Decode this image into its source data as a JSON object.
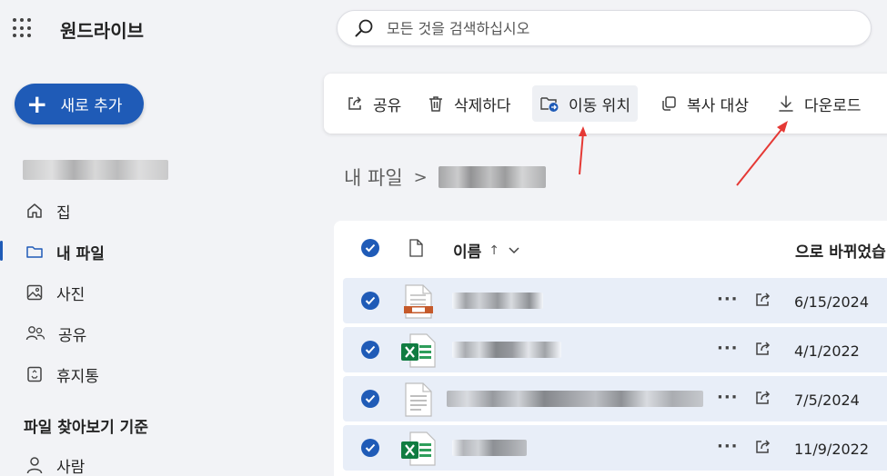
{
  "app": {
    "title": "원드라이브"
  },
  "search": {
    "placeholder": "모든 것을 검색하십시오"
  },
  "new_button": {
    "label": "새로 추가"
  },
  "nav": {
    "items": [
      {
        "label": "집",
        "icon": "home-icon"
      },
      {
        "label": "내 파일",
        "icon": "folder-icon",
        "active": true
      },
      {
        "label": "사진",
        "icon": "photo-icon"
      },
      {
        "label": "공유",
        "icon": "people-icon"
      },
      {
        "label": "휴지통",
        "icon": "recycle-bin-icon"
      }
    ],
    "section_heading": "파일 찾아보기 기준",
    "section_items": [
      {
        "label": "사람",
        "icon": "person-icon"
      }
    ]
  },
  "commands": {
    "share": "공유",
    "delete": "삭제하다",
    "move": "이동 위치",
    "copy": "복사 대상",
    "download": "다운로드"
  },
  "breadcrumb": {
    "root": "내 파일",
    "separator": ">"
  },
  "list": {
    "columns": {
      "name": "이름",
      "sort_indicator": "↑",
      "modified": "으로 바뀌었습"
    },
    "rows": [
      {
        "type": "presentation",
        "modified": "6/15/2024",
        "selected": true
      },
      {
        "type": "excel",
        "modified": "4/1/2022",
        "selected": true
      },
      {
        "type": "document",
        "modified": "7/5/2024",
        "selected": true
      },
      {
        "type": "excel",
        "modified": "11/9/2022",
        "selected": true
      }
    ],
    "more_label": "···"
  },
  "colors": {
    "accent": "#1f5bb7",
    "selected_row": "#e8eef8",
    "annotation_arrow": "#e53935"
  }
}
